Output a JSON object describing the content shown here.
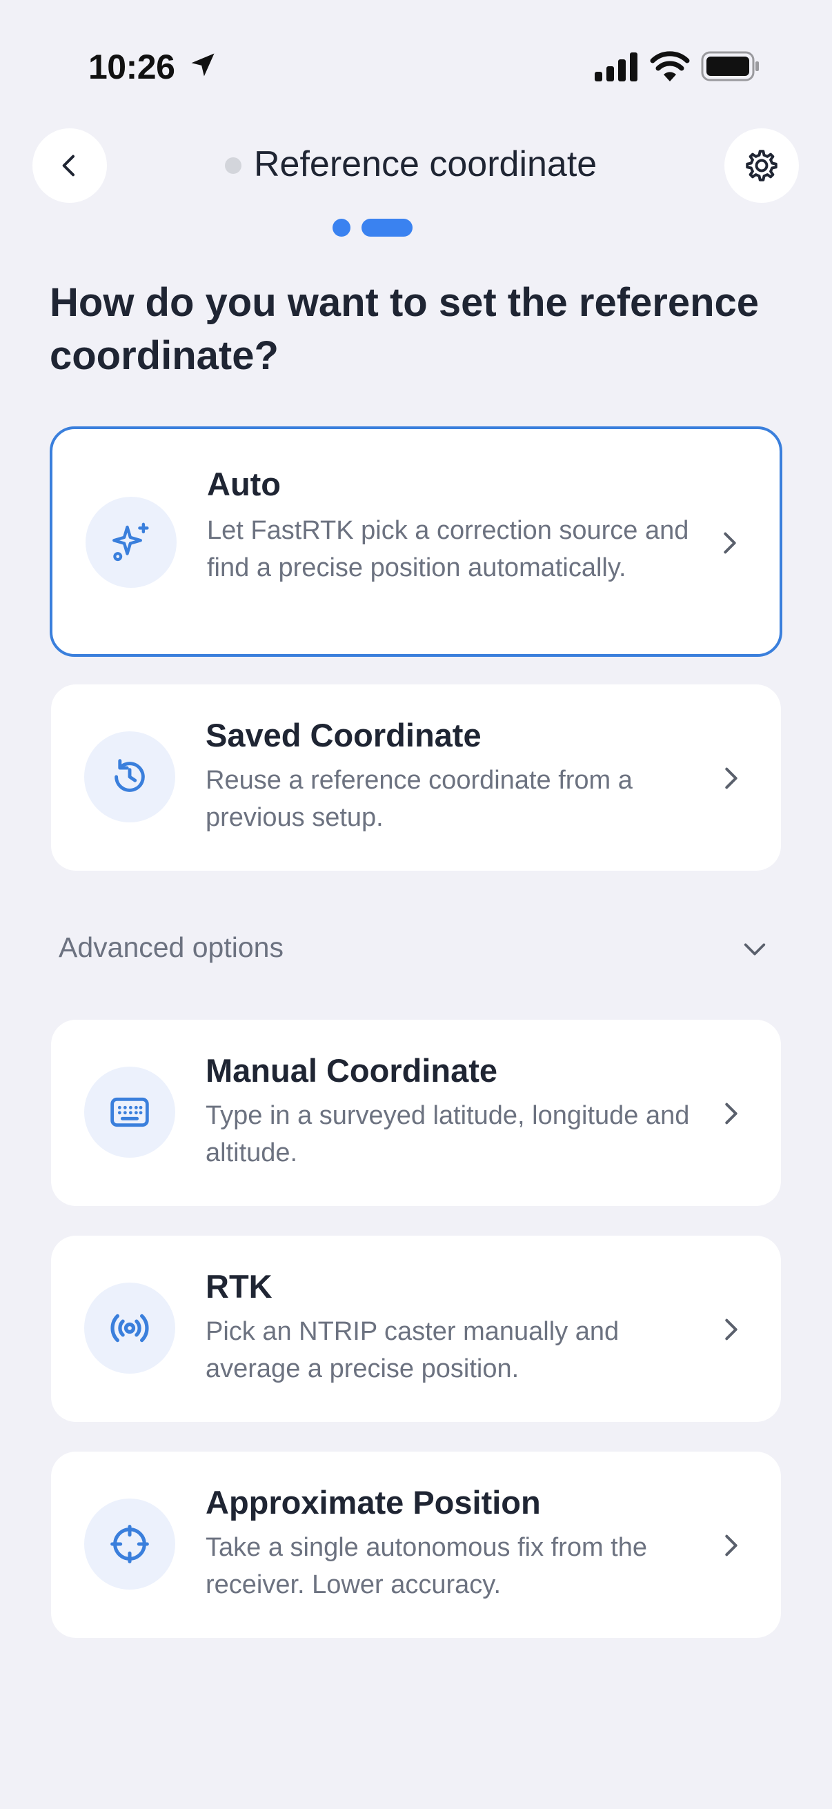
{
  "status_bar": {
    "time": "10:26"
  },
  "header": {
    "title": "Reference coordinate"
  },
  "question": "How do you want to set the reference coordinate?",
  "options": [
    {
      "title": "Auto",
      "description": "Let FastRTK pick a correction source and find a precise position automatically.",
      "icon": "sparkles-icon",
      "selected": true
    },
    {
      "title": "Saved Coordinate",
      "description": "Reuse a reference coordinate from a previous setup.",
      "icon": "history-icon",
      "selected": false
    }
  ],
  "advanced": {
    "label": "Advanced options",
    "options": [
      {
        "title": "Manual Coordinate",
        "description": "Type in a surveyed latitude, longitude and altitude.",
        "icon": "keyboard-icon"
      },
      {
        "title": "RTK",
        "description": "Pick an NTRIP caster manually and average a precise position.",
        "icon": "broadcast-icon"
      },
      {
        "title": "Approximate Position",
        "description": "Take a single autonomous fix from the receiver. Lower accuracy.",
        "icon": "crosshair-icon"
      }
    ]
  },
  "colors": {
    "accent": "#3a82f0",
    "background": "#f1f1f7",
    "card": "#ffffff",
    "icon_bg": "#ecf1fc",
    "muted_text": "#6c7280"
  }
}
